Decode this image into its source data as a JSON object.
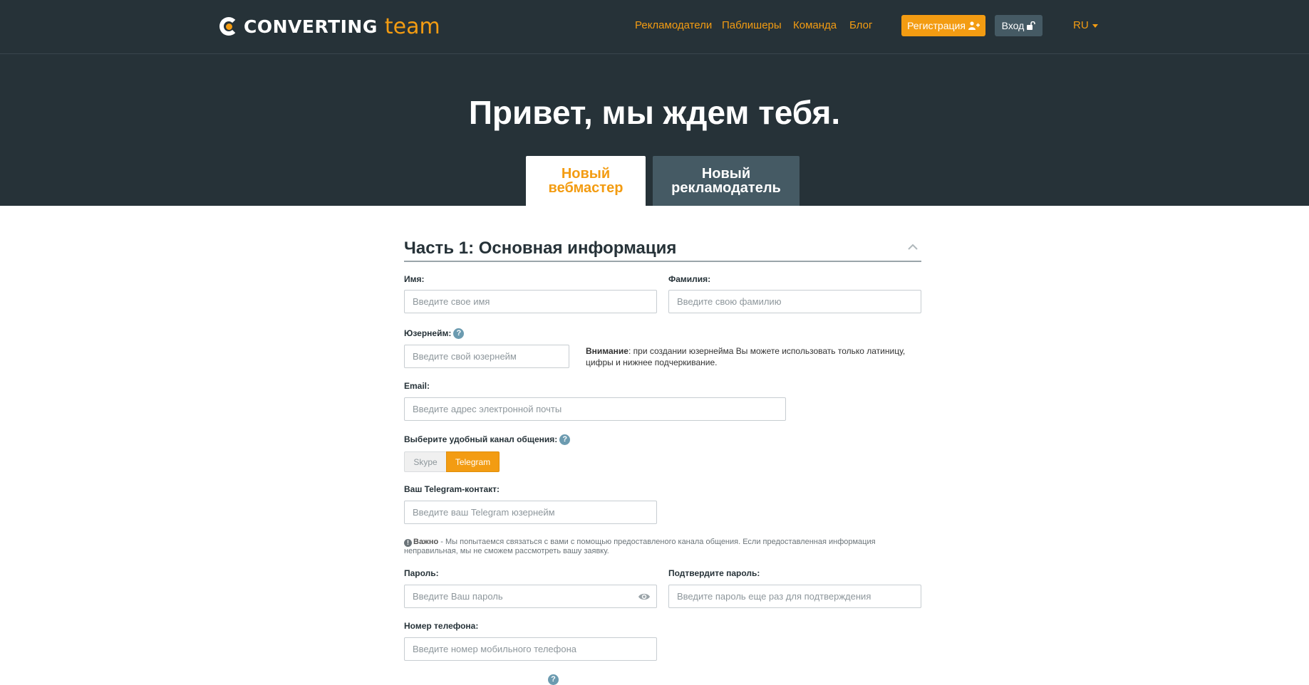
{
  "header": {
    "logo_word": "CONVERTING",
    "logo_team": "team",
    "nav": [
      "Рекламодатели",
      "Паблишеры",
      "Команда",
      "Блог"
    ],
    "register_label": "Регистрация",
    "login_label": "Вход",
    "lang": "RU"
  },
  "hero": {
    "title": "Привет, мы ждем тебя.",
    "tab_webmaster": "Новый вебмастер",
    "tab_advertiser": "Новый рекламодатель"
  },
  "form": {
    "section_title": "Часть 1: Основная информация",
    "first_name": {
      "label": "Имя:",
      "placeholder": "Введите свое имя"
    },
    "last_name": {
      "label": "Фамилия:",
      "placeholder": "Введите свою фамилию"
    },
    "username": {
      "label": "Юзернейм:",
      "placeholder": "Введите свой юзернейм"
    },
    "username_note_strong": "Внимание",
    "username_note": ": при создании юзернейма Вы можете использовать только латиницу, цифры и нижнее подчеркивание.",
    "email": {
      "label": "Email:",
      "placeholder": "Введите адрес электронной почты"
    },
    "channel": {
      "label": "Выберите удобный канал общения:",
      "options": [
        "Skype",
        "Telegram"
      ],
      "selected": "Telegram"
    },
    "telegram": {
      "label": "Ваш Telegram-контакт:",
      "placeholder": "Введите ваш Telegram юзернейм"
    },
    "important_strong": "Важно",
    "important_text": " - Мы попытаемся связаться с вами с помощью предоставленого канала общения. Если предоставленная информация неправильная, мы не сможем рассмотреть вашу заявку.",
    "password": {
      "label": "Пароль:",
      "placeholder": "Введите Ваш пароль"
    },
    "password_confirm": {
      "label": "Подтвердите пароль:",
      "placeholder": "Введите пароль еще раз для подтверждения"
    },
    "phone": {
      "label": "Номер телефона:",
      "placeholder": "Введите номер мобильного телефона"
    }
  },
  "colors": {
    "accent": "#f39c12",
    "dark": "#263238",
    "slate": "#455a64"
  },
  "icons": [
    "user-plus-icon",
    "unlock-icon",
    "chevron-up-icon",
    "help-icon",
    "info-icon",
    "eye-icon"
  ]
}
